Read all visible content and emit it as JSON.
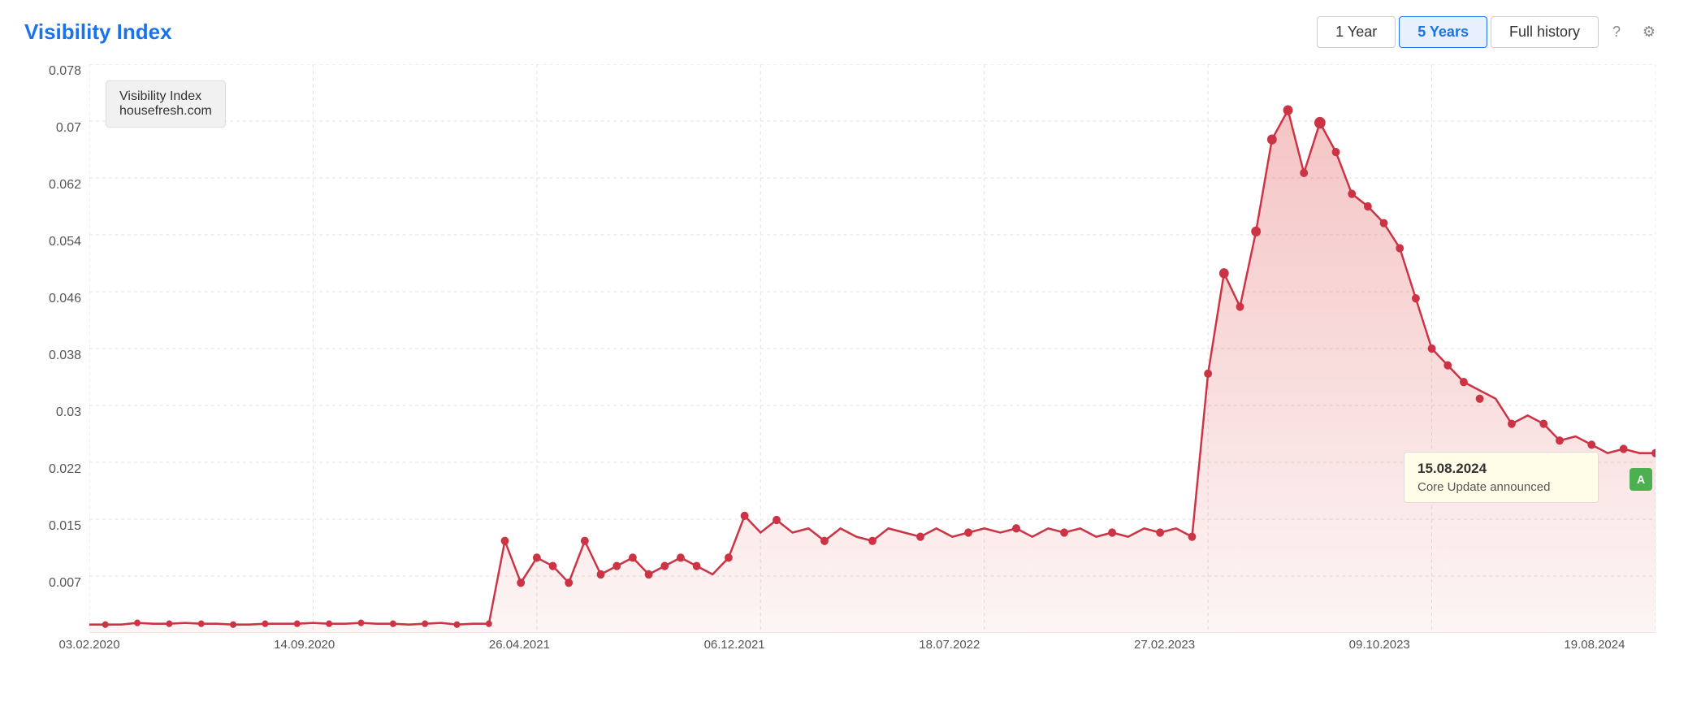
{
  "header": {
    "title": "Visibility Index",
    "time_buttons": [
      {
        "label": "1 Year",
        "active": false
      },
      {
        "label": "5 Years",
        "active": true
      },
      {
        "label": "Full history",
        "active": false
      }
    ]
  },
  "legend": {
    "title": "Visibility Index",
    "domain": "housefresh.com"
  },
  "y_axis": {
    "labels": [
      "0.078",
      "0.07",
      "0.062",
      "0.054",
      "0.046",
      "0.038",
      "0.03",
      "0.022",
      "0.015",
      "0.007",
      ""
    ]
  },
  "x_axis": {
    "labels": [
      "03.02.2020",
      "14.09.2020",
      "26.04.2021",
      "06.12.2021",
      "18.07.2022",
      "27.02.2023",
      "09.10.2023",
      "19.08.2024"
    ]
  },
  "tooltip": {
    "date": "15.08.2024",
    "text": "Core Update announced",
    "marker": "A"
  },
  "chart": {
    "line_color": "#d44",
    "fill_color": "rgba(220,80,80,0.18)"
  }
}
